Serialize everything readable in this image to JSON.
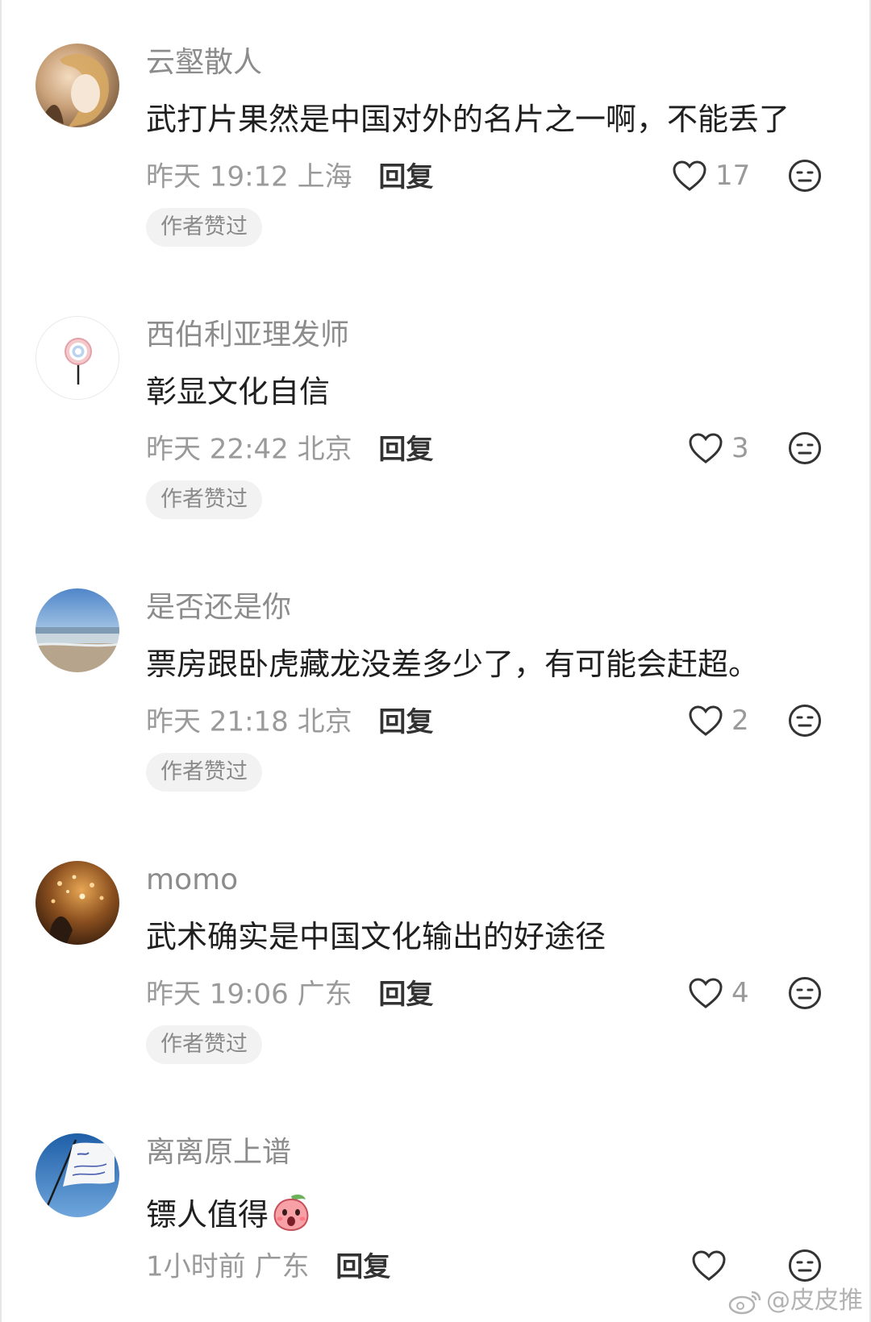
{
  "comments": [
    {
      "username": "云壑散人",
      "text": "武打片果然是中国对外的名片之一啊，不能丢了",
      "time": "昨天 19:12",
      "location": "上海",
      "reply_label": "回复",
      "likes": "17",
      "badge": "作者赞过"
    },
    {
      "username": "西伯利亚理发师",
      "text": "彰显文化自信",
      "time": "昨天 22:42",
      "location": "北京",
      "reply_label": "回复",
      "likes": "3",
      "badge": "作者赞过"
    },
    {
      "username": "是否还是你",
      "text": "票房跟卧虎藏龙没差多少了，有可能会赶超。",
      "time": "昨天 21:18",
      "location": "北京",
      "reply_label": "回复",
      "likes": "2",
      "badge": "作者赞过"
    },
    {
      "username": "momo",
      "text": "武术确实是中国文化输出的好途径",
      "time": "昨天 19:06",
      "location": "广东",
      "reply_label": "回复",
      "likes": "4",
      "badge": "作者赞过"
    },
    {
      "username": "离离原上谱",
      "text": "镖人值得",
      "time": "1小时前",
      "location": "广东",
      "reply_label": "回复",
      "likes": "",
      "badge": ""
    }
  ],
  "icons": {
    "like": "heart-outline-icon",
    "dislike": "neutral-face-icon",
    "emoji": "peach-face-shocked-emoji",
    "watermark": "weibo-logo-icon"
  },
  "watermark": {
    "text": "@皮皮推"
  },
  "colors": {
    "username": "#8c8c8c",
    "body_text": "#1f1f1f",
    "meta": "#9a9a9a",
    "badge_bg": "#f2f2f2"
  }
}
